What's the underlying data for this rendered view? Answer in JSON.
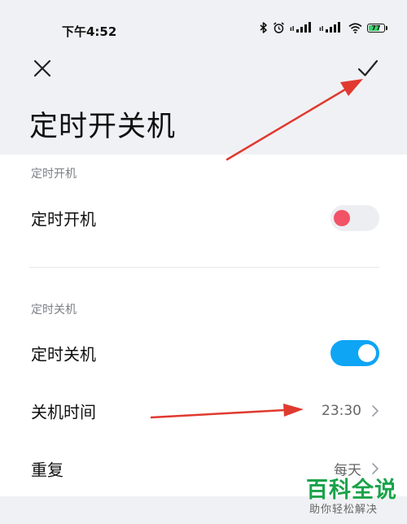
{
  "status_bar": {
    "time": "下午4:52",
    "battery_level": "77",
    "battery_fraction": 0.77,
    "battery_color": "#3bd36b",
    "icons": [
      "bluetooth-icon",
      "alarm-icon",
      "signal-icon",
      "signal-icon",
      "wifi-icon",
      "battery-icon"
    ]
  },
  "header": {
    "close_icon": "close-icon",
    "confirm_icon": "checkmark-icon",
    "title": "定时开关机"
  },
  "sections": {
    "power_on": {
      "label": "定时开机",
      "row_label": "定时开机",
      "toggle_state": "off",
      "knob_color": "#f25266"
    },
    "power_off": {
      "label": "定时关机",
      "row_label": "定时关机",
      "toggle_state": "on",
      "toggle_color": "#0ea5f5",
      "shutdown_time_label": "关机时间",
      "shutdown_time_value": "23:30",
      "repeat_label": "重复",
      "repeat_value": "每天"
    }
  },
  "annotations": {
    "arrow_color": "#e03a2f"
  },
  "watermark": {
    "title": "百科全说",
    "subtitle": "助你轻松解决",
    "color": "#1aa34a"
  }
}
